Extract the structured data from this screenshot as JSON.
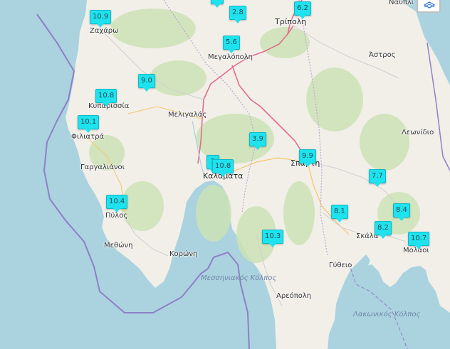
{
  "map": {
    "places": [
      {
        "id": "zacharo",
        "label": "Ζαχάρω",
        "big": false
      },
      {
        "id": "kyparissia",
        "label": "Κυπαρισσία",
        "big": false
      },
      {
        "id": "filiatra",
        "label": "Φιλιατρά",
        "big": false
      },
      {
        "id": "gargaliani",
        "label": "Γαργαλιάνοι",
        "big": false
      },
      {
        "id": "pylos",
        "label": "Πύλος",
        "big": false
      },
      {
        "id": "methoni",
        "label": "Μεθώνη",
        "big": false
      },
      {
        "id": "koroni",
        "label": "Κορώνη",
        "big": false
      },
      {
        "id": "meligalas",
        "label": "Μελιγαλάς",
        "big": false
      },
      {
        "id": "megalopoli",
        "label": "Μεγαλόπολη",
        "big": false
      },
      {
        "id": "tripoli",
        "label": "Τρίπολη",
        "big": true
      },
      {
        "id": "kalamata",
        "label": "Καλαμάτα",
        "big": true
      },
      {
        "id": "sparti",
        "label": "Σπάρτη",
        "big": true
      },
      {
        "id": "astros",
        "label": "Άστρος",
        "big": false
      },
      {
        "id": "leonidio",
        "label": "Λεωνίδιο",
        "big": false
      },
      {
        "id": "gytheio",
        "label": "Γύθειο",
        "big": false
      },
      {
        "id": "areopoli",
        "label": "Αρεόπολη",
        "big": false
      },
      {
        "id": "skala",
        "label": "Σκάλα",
        "big": false
      },
      {
        "id": "molaoi",
        "label": "Μολάοι",
        "big": false
      },
      {
        "id": "nafplio",
        "label": "Ναύπλι",
        "big": false
      }
    ],
    "seas": [
      {
        "id": "messiniakos",
        "label": "Μεσσηνιακός Κόλπος"
      },
      {
        "id": "lakonikos",
        "label": "Λακωνικός Κόλπος"
      }
    ],
    "markers": [
      {
        "id": "zacharo",
        "value": "10.9"
      },
      {
        "id": "top-hidden",
        "value": ""
      },
      {
        "id": "north",
        "value": "2.8"
      },
      {
        "id": "tripoli",
        "value": "6.2"
      },
      {
        "id": "megalopoli",
        "value": "5.6"
      },
      {
        "id": "ne-kyparissia",
        "value": "9.0"
      },
      {
        "id": "kyparissia",
        "value": "10.8"
      },
      {
        "id": "filiatra",
        "value": "10.1"
      },
      {
        "id": "central",
        "value": "3.9"
      },
      {
        "id": "sparti",
        "value": "9.9"
      },
      {
        "id": "kalamata-back",
        "value": "1"
      },
      {
        "id": "kalamata",
        "value": "10.8"
      },
      {
        "id": "east",
        "value": "7.7"
      },
      {
        "id": "pylos",
        "value": "10.4"
      },
      {
        "id": "sparti-south",
        "value": "8.1"
      },
      {
        "id": "molaoi-north",
        "value": "8.4"
      },
      {
        "id": "skala",
        "value": "8.2"
      },
      {
        "id": "molaoi",
        "value": "10.7"
      },
      {
        "id": "mani",
        "value": "10.3"
      }
    ],
    "layers_control": {
      "icon": "layers-icon"
    },
    "colors": {
      "sea": "#aad3df",
      "land": "#f2efe9",
      "marker": "#1ee3ee",
      "boundary": "#8f7fc6",
      "road": "#e06d8b"
    }
  }
}
